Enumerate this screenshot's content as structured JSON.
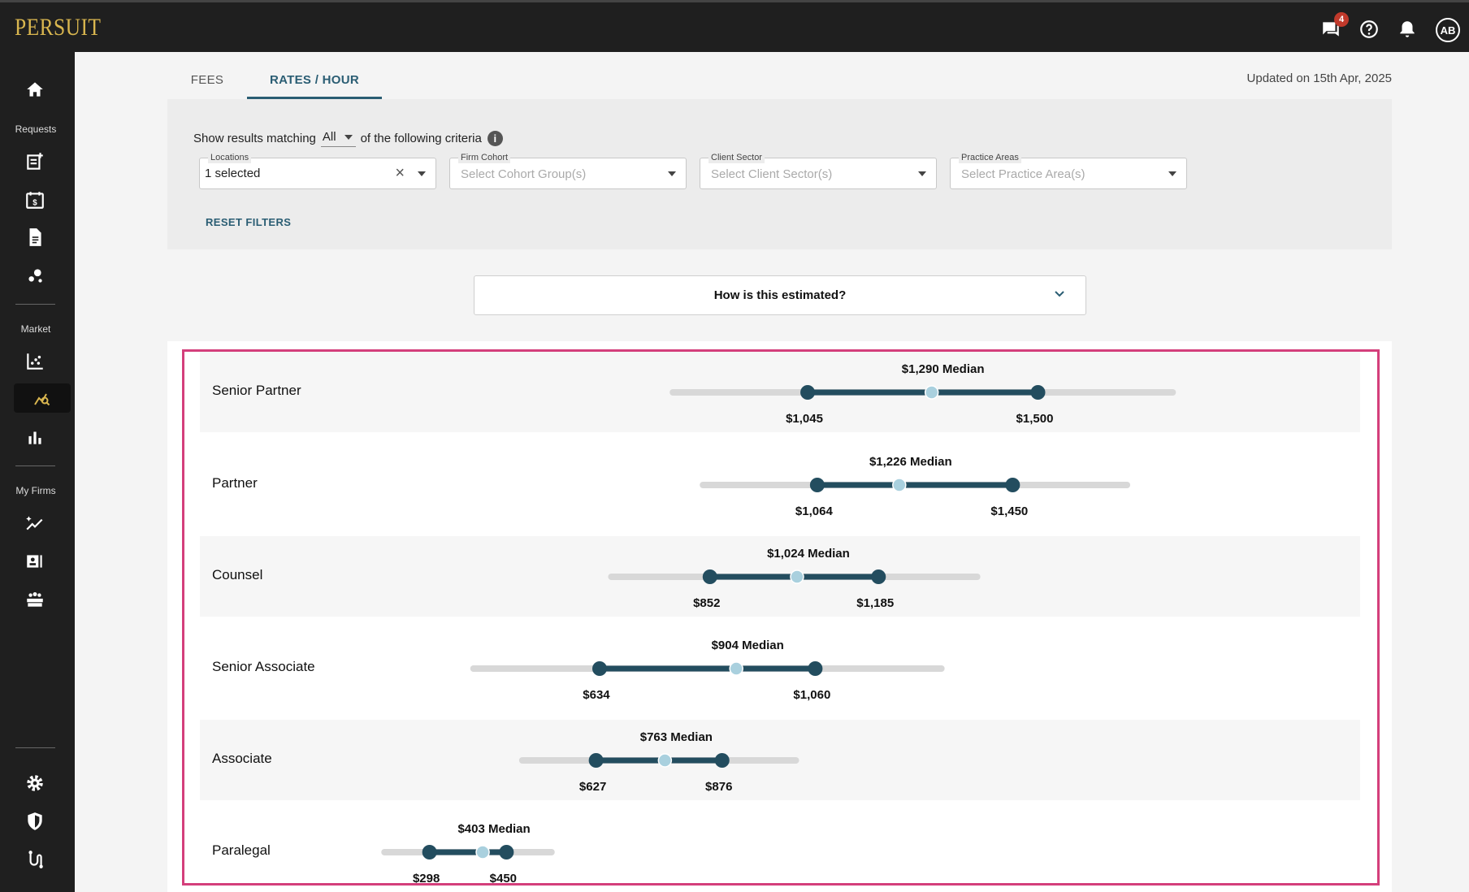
{
  "header": {
    "logo": "PERSUIT",
    "chat_badge": "4",
    "avatar": "AB",
    "icons": [
      "chat-icon",
      "help-icon",
      "bell-icon"
    ]
  },
  "sidebar": {
    "sections": {
      "requests": "Requests",
      "market": "Market",
      "my_firms": "My Firms"
    },
    "icons": [
      "home-icon",
      "new-request-icon",
      "billing-calendar-icon",
      "document-icon",
      "graph-nodes-icon",
      "scatter-chart-icon",
      "rate-search-icon",
      "bar-chart-icon",
      "sparkle-trend-icon",
      "firm-card-icon",
      "team-icon",
      "settings-icon",
      "shield-icon",
      "integration-icon"
    ],
    "active": "rate-search-icon"
  },
  "tabs": [
    {
      "label": "FEES"
    },
    {
      "label": "RATES / HOUR",
      "active": true
    }
  ],
  "updated": "Updated on 15th Apr, 2025",
  "filters": {
    "criteria_prefix": "Show results matching",
    "match_value": "All",
    "criteria_suffix": "of the following criteria",
    "locations": {
      "label": "Locations",
      "value": "1 selected"
    },
    "firm_cohort": {
      "label": "Firm Cohort",
      "placeholder": "Select Cohort Group(s)"
    },
    "client_sector": {
      "label": "Client Sector",
      "placeholder": "Select Client Sector(s)"
    },
    "practice_areas": {
      "label": "Practice Areas",
      "placeholder": "Select Practice Area(s)"
    },
    "reset": "RESET FILTERS"
  },
  "estimate": {
    "label": "How is this estimated?"
  },
  "colors": {
    "accent": "#2a5d73",
    "bar_dark": "#234d5f",
    "median_dot": "#a9d0de",
    "track": "#d8d8d8",
    "highlight": "#d43f7b",
    "brand": "#d9b64f"
  },
  "rates": [
    {
      "role": "Senior Partner",
      "low": 1045,
      "median": 1290,
      "high": 1500,
      "low_label": "$1,045",
      "high_label": "$1,500",
      "median_label": "$1,290 Median"
    },
    {
      "role": "Partner",
      "low": 1064,
      "median": 1226,
      "high": 1450,
      "low_label": "$1,064",
      "high_label": "$1,450",
      "median_label": "$1,226 Median"
    },
    {
      "role": "Counsel",
      "low": 852,
      "median": 1024,
      "high": 1185,
      "low_label": "$852",
      "high_label": "$1,185",
      "median_label": "$1,024 Median"
    },
    {
      "role": "Senior Associate",
      "low": 634,
      "median": 904,
      "high": 1060,
      "low_label": "$634",
      "high_label": "$1,060",
      "median_label": "$904 Median"
    },
    {
      "role": "Associate",
      "low": 627,
      "median": 763,
      "high": 876,
      "low_label": "$627",
      "high_label": "$876",
      "median_label": "$763 Median"
    },
    {
      "role": "Paralegal",
      "low": 298,
      "median": 403,
      "high": 450,
      "low_label": "$298",
      "high_label": "$450",
      "median_label": "$403 Median"
    }
  ]
}
